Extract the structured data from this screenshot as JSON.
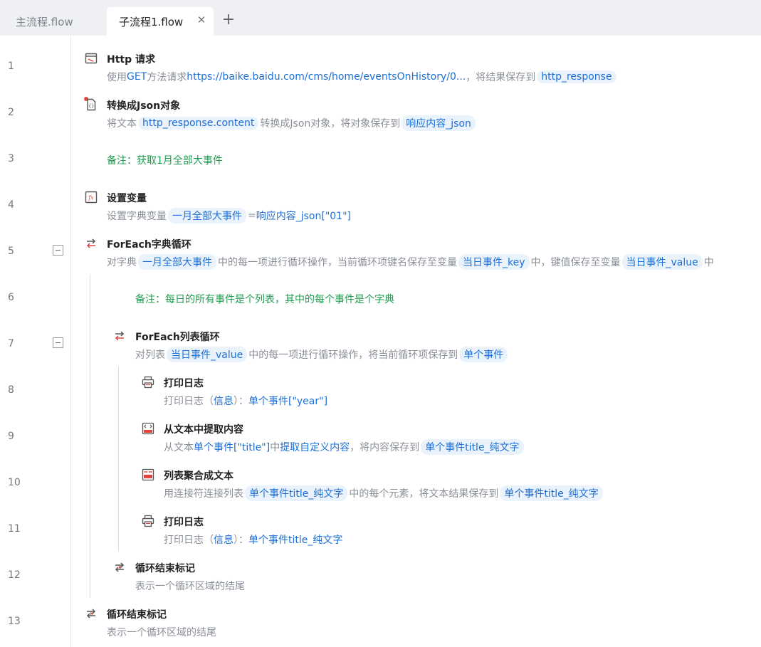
{
  "tabs": [
    {
      "label": "主流程.flow",
      "active": false
    },
    {
      "label": "子流程1.flow",
      "active": true
    }
  ],
  "tab_close": "✕",
  "tab_add": "+",
  "line_numbers": [
    "1",
    "2",
    "3",
    "4",
    "5",
    "6",
    "7",
    "8",
    "9",
    "10",
    "11",
    "12",
    "13"
  ],
  "steps": {
    "http": {
      "title": "Http 请求",
      "d1": "使用",
      "d2": "GET",
      "d3": "方法请求",
      "d4": "https://baike.baidu.com/cms/home/eventsOnHistory/0...",
      "d5": "，将结果保存到",
      "d6": "http_response"
    },
    "json": {
      "title": "转换成Json对象",
      "d1": "将文本",
      "d2": "http_response.content",
      "d3": "转换成Json对象，将对象保存到",
      "d4": "响应内容_json"
    },
    "note1": {
      "text": "备注：获取1月全部大事件"
    },
    "setvar": {
      "title": "设置变量",
      "d1": "设置字典变量",
      "d2": "一月全部大事件",
      "d3": "=",
      "d4": "响应内容_json[\"01\"]"
    },
    "foreach_dict": {
      "title": "ForEach字典循环",
      "d1": "对字典",
      "d2": "一月全部大事件",
      "d3": "中的每一项进行循环操作，当前循环项键名保存至变量",
      "d4": "当日事件_key",
      "d5": "中，键值保存至变量",
      "d6": "当日事件_value",
      "d7": "中"
    },
    "note2": {
      "text": "备注：每日的所有事件是个列表，其中的每个事件是个字典"
    },
    "foreach_list": {
      "title": "ForEach列表循环",
      "d1": "对列表",
      "d2": "当日事件_value",
      "d3": "中的每一项进行循环操作，将当前循环项保存到",
      "d4": "单个事件"
    },
    "print1": {
      "title": "打印日志",
      "d1": "打印日志（",
      "d2": "信息",
      "d3": "）：",
      "d4": "单个事件[\"year\"]"
    },
    "extract": {
      "title": "从文本中提取内容",
      "d1": "从文本",
      "d2": "单个事件[\"title\"]",
      "d3": "中",
      "d4": "提取自定义内容",
      "d5": "，将内容保存到",
      "d6": "单个事件title_纯文字"
    },
    "join": {
      "title": "列表聚合成文本",
      "d1": "用连接符连接列表",
      "d2": "单个事件title_纯文字",
      "d3": "中的每个元素，将文本结果保存到",
      "d4": "单个事件title_纯文字"
    },
    "print2": {
      "title": "打印日志",
      "d1": "打印日志（",
      "d2": "信息",
      "d3": "）：",
      "d4": "单个事件title_纯文字"
    },
    "end_inner": {
      "title": "循环结束标记",
      "desc": "表示一个循环区域的结尾"
    },
    "end_outer": {
      "title": "循环结束标记",
      "desc": "表示一个循环区域的结尾"
    }
  },
  "colors": {
    "accent": "#1c6fd6",
    "note": "#1f9d4f",
    "muted": "#8a8f98"
  }
}
